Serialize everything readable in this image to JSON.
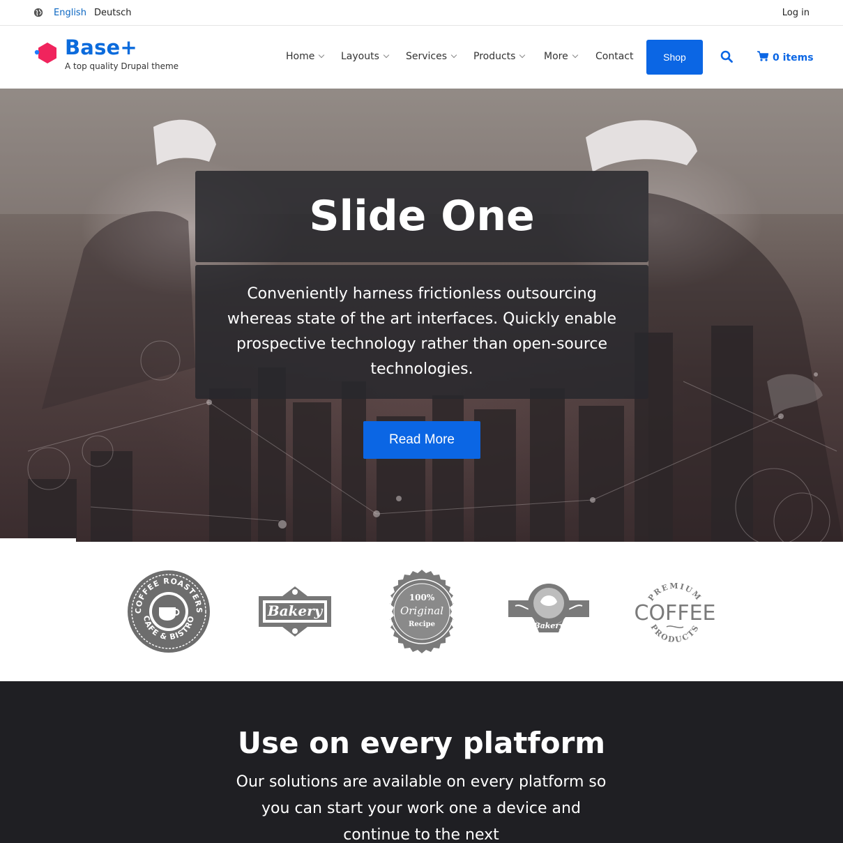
{
  "topbar": {
    "globe_icon": "globe-icon",
    "languages": [
      "English",
      "Deutsch"
    ],
    "active_language": "English",
    "login": "Log in"
  },
  "header": {
    "site_name": "Base+",
    "slogan": "A top quality Drupal theme",
    "nav": [
      {
        "label": "Home",
        "has_submenu": true
      },
      {
        "label": "Layouts",
        "has_submenu": true
      },
      {
        "label": "Services",
        "has_submenu": true
      },
      {
        "label": "Products",
        "has_submenu": true
      },
      {
        "label": "More",
        "has_submenu": true
      },
      {
        "label": "Contact",
        "has_submenu": false
      }
    ],
    "shop_label": "Shop",
    "search_icon": "search-icon",
    "cart_label": "0 items",
    "cart_icon": "cart-icon"
  },
  "hero": {
    "title": "Slide One",
    "text": "Conveniently harness frictionless outsourcing whereas state of the art interfaces. Quickly enable prospective technology rather than open-source technologies.",
    "button": "Read More"
  },
  "logos": [
    {
      "name": "coffee-roasters-logo",
      "top": "COFFEE ROASTERS",
      "bottom": "CAFE & BISTRO"
    },
    {
      "name": "bakery-logo",
      "text": "Bakery"
    },
    {
      "name": "original-recipe-logo",
      "top": "100%",
      "middle": "Original",
      "bottom": "Recipe"
    },
    {
      "name": "bakery-ribbon-logo",
      "text": "Bakery"
    },
    {
      "name": "premium-coffee-logo",
      "top": "PREMIUM",
      "middle": "COFFEE",
      "bottom": "PRODUCTS"
    }
  ],
  "platform": {
    "title": "Use on every platform",
    "text": "Our solutions are available on every platform so you can start your work one a device and continue to the next"
  },
  "colors": {
    "brand": "#0b6bdc",
    "button": "#0b66e4",
    "accent_logo": "#f0245d",
    "dark_section": "#1f1f23"
  }
}
